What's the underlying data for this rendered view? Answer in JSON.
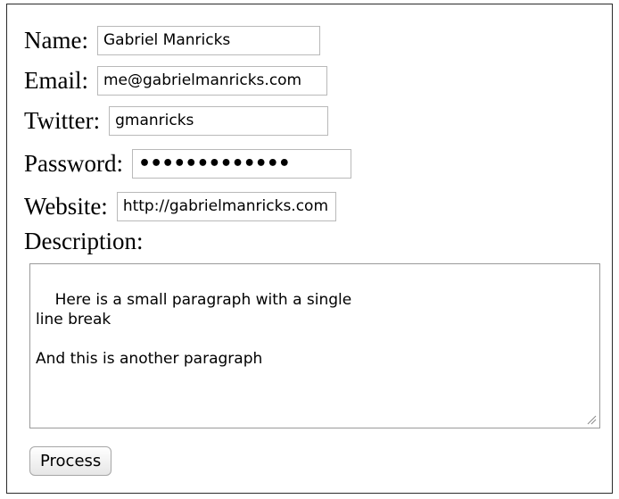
{
  "form": {
    "name": {
      "label": "Name:",
      "value": "Gabriel Manricks"
    },
    "email": {
      "label": "Email:",
      "value": "me@gabrielmanricks.com"
    },
    "twitter": {
      "label": "Twitter:",
      "value": "gmanricks"
    },
    "password": {
      "label": "Password:",
      "value": "•••••••••••••"
    },
    "website": {
      "label": "Website:",
      "value": "http://gabrielmanricks.com"
    },
    "description": {
      "label": "Description:",
      "value": "Here is a small paragraph with a single\nline break\n\nAnd this is another paragraph"
    },
    "submit_label": "Process"
  },
  "colors": {
    "border": "#b9b9b9",
    "frame": "#2b2b2b",
    "button_bg": "#e6e6e6"
  }
}
